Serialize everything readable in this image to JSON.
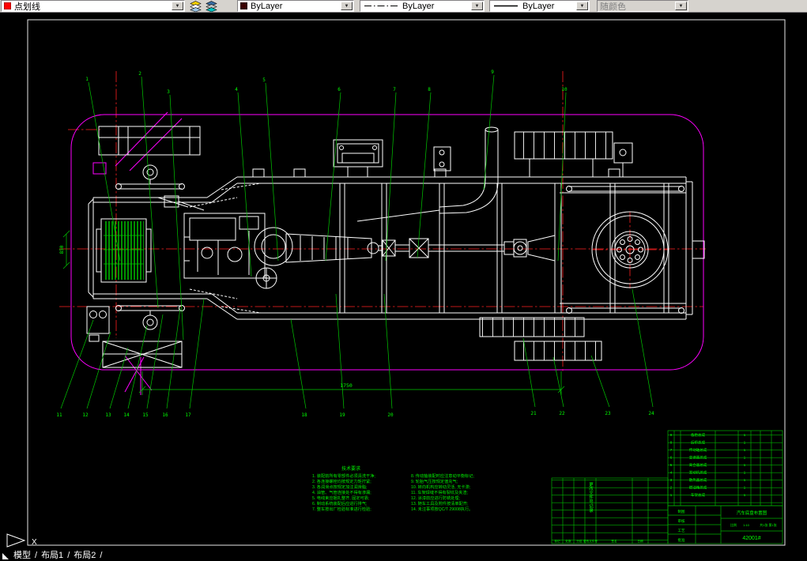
{
  "toolbar": {
    "layer_control": {
      "value": "点划线",
      "swatch": "#ff0000"
    },
    "color_control": {
      "value": "ByLayer",
      "swatch": "#3a0000"
    },
    "linetype_control": {
      "value": "ByLayer"
    },
    "lineweight_control": {
      "value": "ByLayer"
    },
    "plotstyle_control": {
      "value": "随颜色"
    },
    "dropdown_arrow": "▼"
  },
  "statusbar": {
    "ucs_axis": "X",
    "tabs": [
      "模型",
      "布局1",
      "布局2"
    ],
    "tab_separator": "/"
  },
  "drawing": {
    "callouts_top": [
      "1",
      "2",
      "3",
      "4",
      "5",
      "6",
      "7",
      "8",
      "9",
      "10"
    ],
    "callouts_bottom": [
      "11",
      "12",
      "13",
      "14",
      "15",
      "16",
      "17",
      "18",
      "19",
      "20",
      "21",
      "22",
      "23",
      "24"
    ],
    "dimensions": {
      "length": "1750",
      "width": "850"
    },
    "notes_title": "技术要求",
    "notes_left": [
      "1. 装配前所有零部件必须清洗干净;",
      "2. 各连接螺栓均按规定力矩拧紧;",
      "3. 各润滑点按规定加注润滑脂;",
      "4. 油管、气管连接处不得有渗漏;",
      "5. 电线束应捆扎整齐, 固定可靠;",
      "6. 制动系统装配后应进行排气;",
      "7. 整车按出厂检验标准进行检验;"
    ],
    "notes_right": [
      "8. 传动轴装配时应注意动平衡标记;",
      "9. 轮胎气压按规定值充气;",
      "10. 转向机构应转动灵活, 无卡滞;",
      "11. 车架焊缝不得有裂纹及夹渣;",
      "12. 涂漆前应进行防锈处理;",
      "13. 随车工具及附件按清单配齐;",
      "14. 未注事项按QC/T 29008执行。"
    ],
    "parts_list": {
      "numbers": [
        "9",
        "8",
        "7",
        "6",
        "5",
        "4",
        "3",
        "2",
        "1"
      ],
      "names": [
        "备胎总成",
        "后桥总成",
        "传动轴总成",
        "变速器总成",
        "离合器总成",
        "发动机总成",
        "散热器总成",
        "燃油箱总成",
        "车架总成"
      ],
      "qtys": [
        "1",
        "1",
        "1",
        "1",
        "1",
        "1",
        "1",
        "1",
        "1"
      ]
    },
    "title_block": {
      "rows": [
        "制图",
        "审核",
        "工艺",
        "批准"
      ],
      "title": "汽车底盘布置图",
      "scale_label": "比例",
      "scale": "1:10",
      "sheet": "共1张 第1张",
      "drawing_no": "42001#"
    },
    "revision_table": {
      "headers": [
        "标记",
        "处数",
        "分区",
        "更改文件号",
        "签名",
        "日期"
      ],
      "column_note": "更改文件号记录"
    }
  }
}
